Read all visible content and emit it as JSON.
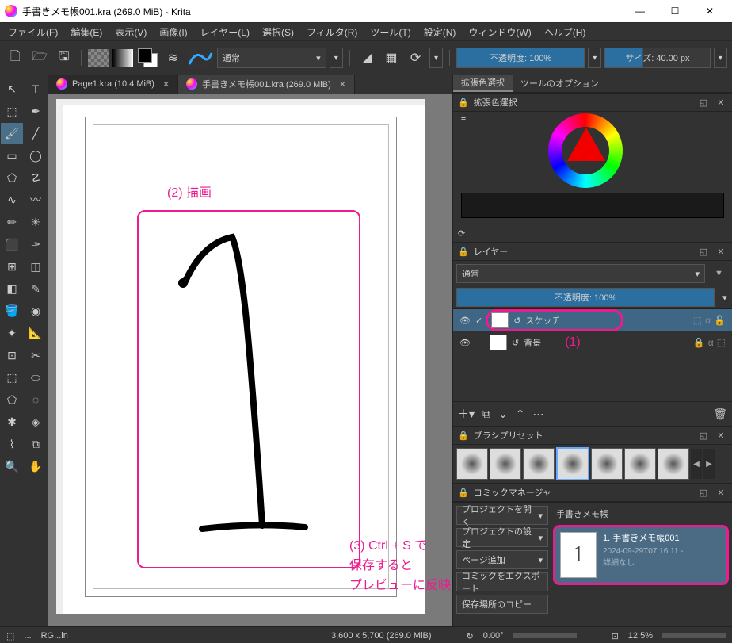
{
  "window": {
    "title": "手書きメモ帳001.kra (269.0 MiB)  -  Krita",
    "min": "—",
    "max": "☐",
    "close": "✕"
  },
  "menu": {
    "file": "ファイル(F)",
    "edit": "編集(E)",
    "view": "表示(V)",
    "image": "画像(I)",
    "layer": "レイヤー(L)",
    "select": "選択(S)",
    "filter": "フィルタ(R)",
    "tools": "ツール(T)",
    "settings": "設定(N)",
    "window": "ウィンドウ(W)",
    "help": "ヘルプ(H)"
  },
  "toolbar": {
    "blend_mode": "通常",
    "opacity": "不透明度: 100%",
    "size": "サイズ: 40.00 px"
  },
  "tabs": {
    "tab1": "Page1.kra (10.4 MiB)",
    "tab2": "手書きメモ帳001.kra (269.0 MiB)"
  },
  "annotations": {
    "a2": "(2) 描画",
    "a1": "(1)",
    "a3a": "(3) Ctrl + S で",
    "a3b": "保存すると",
    "a3c": "プレビューに反映されました。"
  },
  "dock": {
    "tab_color": "拡張色選択",
    "tab_tool": "ツールのオプション",
    "color_title": "拡張色選択",
    "layer_title": "レイヤー",
    "blend": "通常",
    "opacity": "不透明度: 100%",
    "layer1": "スケッチ",
    "layer2": "背景",
    "preset_title": "ブラシプリセット",
    "comic_title": "コミックマネージャ",
    "comic_tab": "手書きメモ帳"
  },
  "comic_buttons": {
    "open": "プロジェクトを開く",
    "settings": "プロジェクトの設定",
    "addpage": "ページ追加",
    "export": "コミックをエクスポート",
    "copy": "保存場所のコピー"
  },
  "comic_card": {
    "title": "1. 手書きメモ帳001",
    "time": "2024-09-29T07:16:11 -",
    "detail": "詳細なし"
  },
  "status": {
    "left": "RG...in",
    "dims": "3,600 x 5,700 (269.0 MiB)",
    "angle": "0.00°",
    "zoom": "12.5%"
  }
}
